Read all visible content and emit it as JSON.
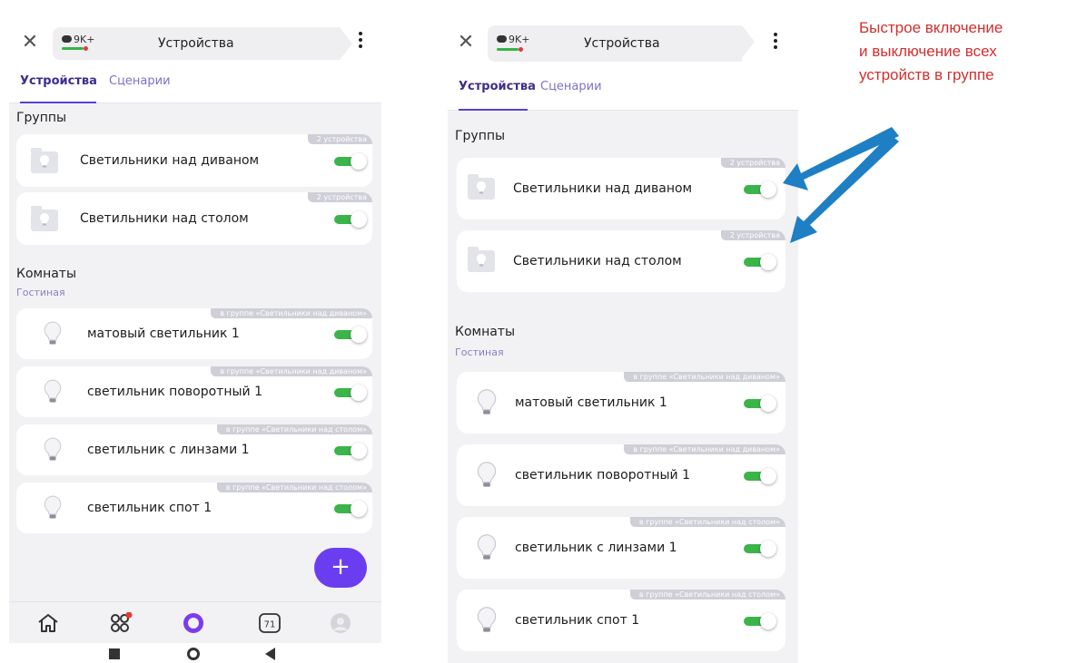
{
  "app": {
    "chat_count": "9K+",
    "title": "Устройства"
  },
  "tabs": [
    {
      "label": "Устройства",
      "active": true
    },
    {
      "label": "Сценарии",
      "active": false
    }
  ],
  "groups": {
    "title": "Группы",
    "items": [
      {
        "label": "Светильники над диваном",
        "badge": "2 устройства",
        "enabled": true
      },
      {
        "label": "Светильники над столом",
        "badge": "2 устройства",
        "enabled": true
      }
    ]
  },
  "rooms": {
    "title": "Комнаты",
    "room_name": "Гостиная",
    "items": [
      {
        "label": "матовый светильник 1",
        "badge": "в группе «Светильники над диваном»",
        "enabled": true
      },
      {
        "label": "светильник поворотный 1",
        "badge": "в группе «Светильники над диваном»",
        "enabled": true
      },
      {
        "label": "светильник с линзами 1",
        "badge": "в группе «Светильники над столом»",
        "enabled": true
      },
      {
        "label": "светильник спот 1",
        "badge": "в группе «Светильники над столом»",
        "enabled": true
      }
    ]
  },
  "fab_label": "+",
  "bottom_nav": {
    "calendar_day": "71"
  },
  "annotation": {
    "line1": "Быстрое включение",
    "line2": "и выключение всех",
    "line3": "устройств в группе"
  },
  "colors": {
    "accent": "#6b3df0",
    "toggle_on": "#3bb54a",
    "annotation": "#d32f2f",
    "arrow": "#1e7fc4"
  }
}
